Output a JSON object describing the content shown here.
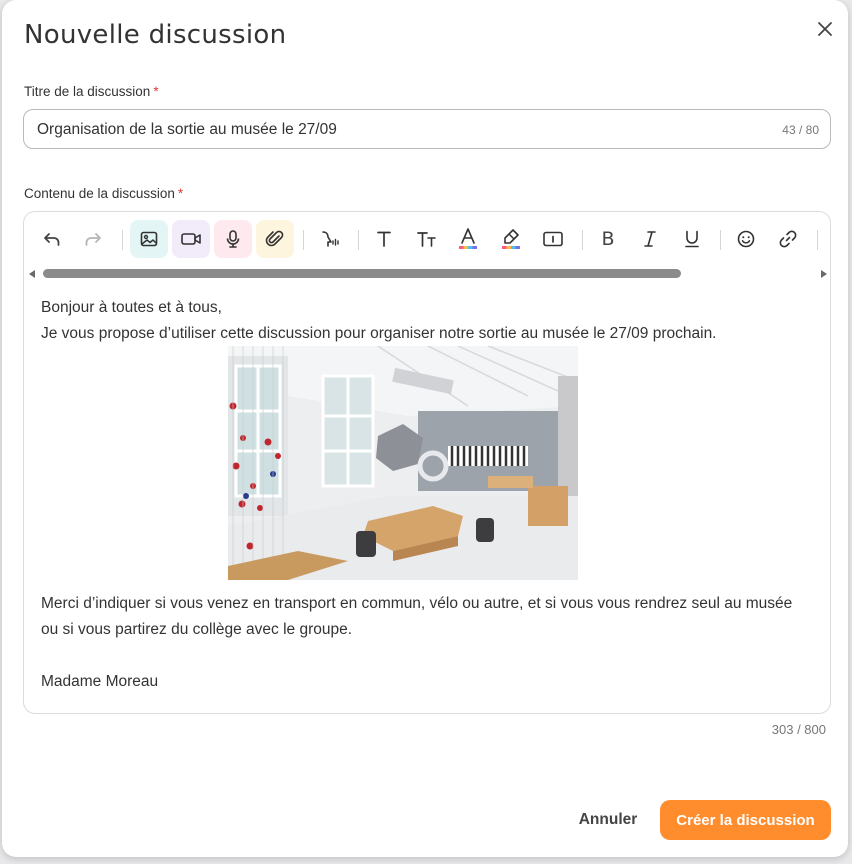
{
  "modal": {
    "title": "Nouvelle discussion",
    "close_icon": "close-icon"
  },
  "title_field": {
    "label": "Titre de la discussion",
    "required_mark": "*",
    "value": "Organisation de la sortie au musée le 27/09",
    "counter": "43 / 80"
  },
  "content_field": {
    "label": "Contenu de la discussion",
    "required_mark": "*",
    "counter": "303 / 800"
  },
  "toolbar": {
    "buttons": [
      {
        "icon": "undo-icon"
      },
      {
        "icon": "redo-icon"
      },
      {
        "icon": "image-icon",
        "bg": "#e3f6f5"
      },
      {
        "icon": "video-icon",
        "bg": "#f1ebfa"
      },
      {
        "icon": "microphone-icon",
        "bg": "#fde9ee"
      },
      {
        "icon": "attachment-icon",
        "bg": "#fdf5dd"
      },
      {
        "icon": "speech-icon"
      },
      {
        "icon": "text-icon",
        "glyph": "T"
      },
      {
        "icon": "text-size-icon",
        "glyph": "TT"
      },
      {
        "icon": "text-color-icon",
        "glyph": "A"
      },
      {
        "icon": "highlight-icon"
      },
      {
        "icon": "info-box-icon"
      },
      {
        "icon": "bold-icon",
        "glyph": "B"
      },
      {
        "icon": "italic-icon",
        "glyph": "I"
      },
      {
        "icon": "underline-icon",
        "glyph": "U"
      },
      {
        "icon": "emoji-icon"
      },
      {
        "icon": "link-icon"
      }
    ]
  },
  "content": {
    "line1": "Bonjour à toutes et à tous,",
    "line2": "Je vous propose d’utiliser cette discussion pour organiser notre sortie au musée le 27/09 prochain.",
    "image_icon": "museum-photo",
    "line3": "Merci d’indiquer si vous venez en transport en commun, vélo ou autre, et si vous vous rendrez seul au musée",
    "line4": "ou si vous partirez du collège avec le groupe.",
    "signature": "Madame Moreau"
  },
  "actions": {
    "cancel_label": "Annuler",
    "create_label": "Créer la discussion"
  },
  "colors": {
    "accent": "#ff8d2e",
    "required": "#e23b3b"
  }
}
